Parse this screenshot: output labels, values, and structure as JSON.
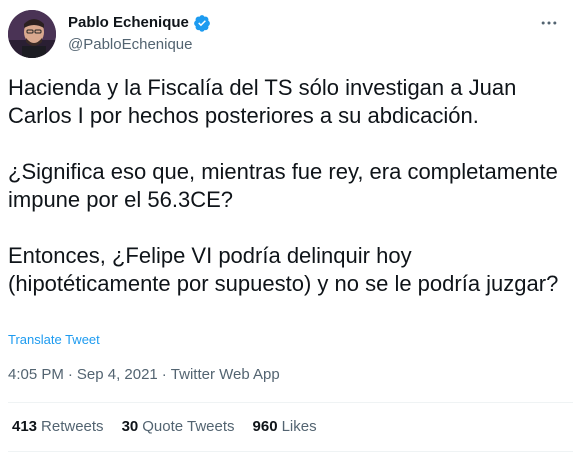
{
  "author": {
    "display_name": "Pablo Echenique",
    "handle": "@PabloEchenique",
    "verified": true,
    "verified_color": "#1d9bf0"
  },
  "tweet": {
    "paragraphs": [
      "Hacienda y la Fiscalía del TS sólo investigan a Juan Carlos I por hechos posteriores a su abdicación.",
      "¿Significa eso que, mientras fue rey, era completamente impune por el 56.3CE?",
      "Entonces, ¿Felipe VI podría delinquir hoy (hipotéticamente por supuesto) y no se le podría juzgar?"
    ],
    "translate_label": "Translate Tweet"
  },
  "meta": {
    "time": "4:05 PM",
    "separator": "·",
    "date": "Sep 4, 2021",
    "source": "Twitter Web App"
  },
  "stats": {
    "retweets_count": "413",
    "retweets_label": "Retweets",
    "quotes_count": "30",
    "quotes_label": "Quote Tweets",
    "likes_count": "960",
    "likes_label": "Likes"
  },
  "icons": {
    "verified": "verified-badge-icon",
    "more": "more-options-icon"
  }
}
